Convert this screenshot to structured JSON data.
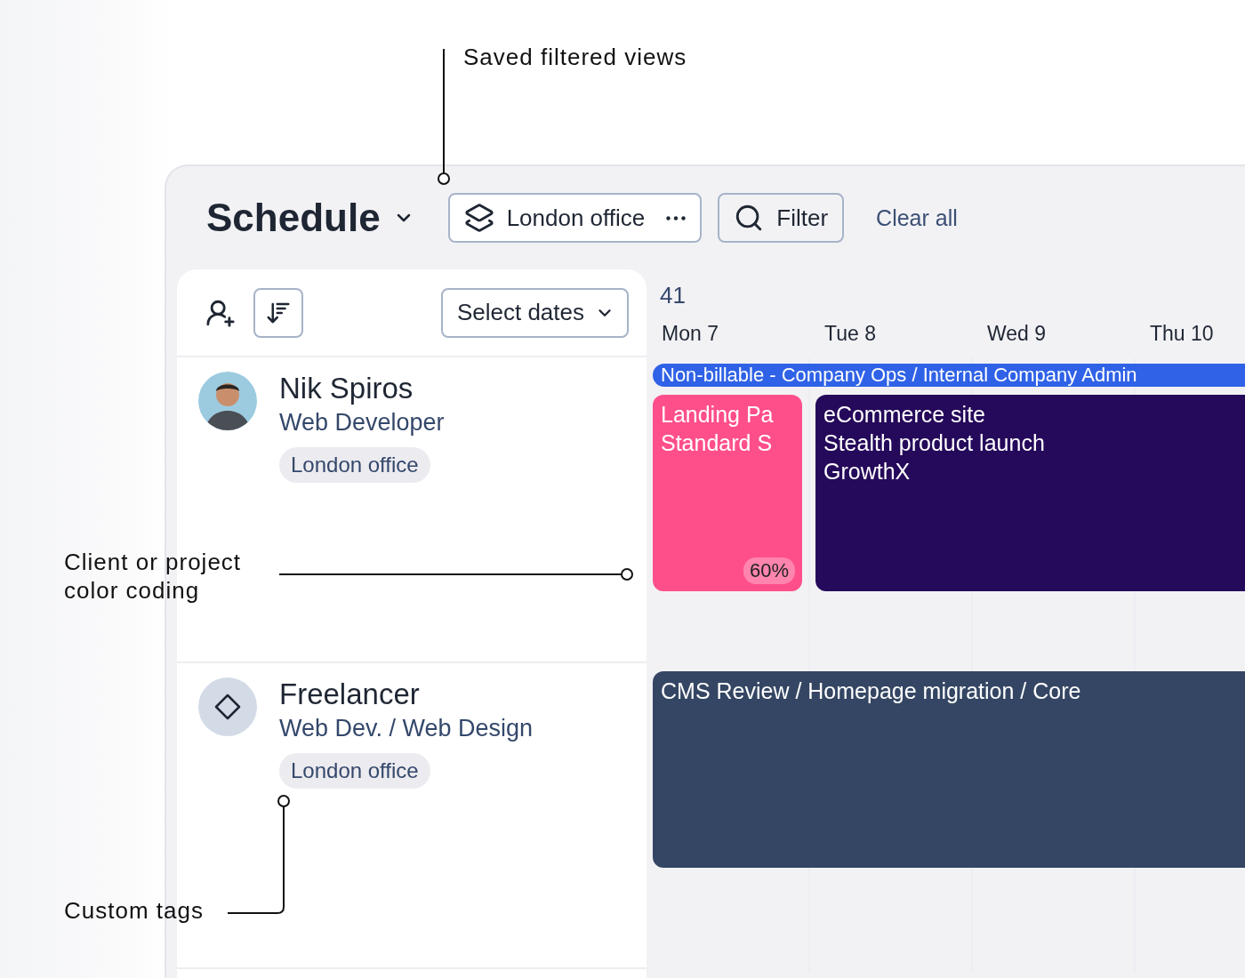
{
  "annotations": [
    {
      "kind": "top",
      "text": "Saved filtered views"
    },
    {
      "kind": "side",
      "text": "Client or project\ncolor coding"
    },
    {
      "kind": "tag",
      "text": "Custom tags"
    }
  ],
  "header": {
    "title": "Schedule",
    "saved_view": "London office",
    "filter": "Filter",
    "clear": "Clear all"
  },
  "toolbar": {
    "date_picker": "Select dates"
  },
  "calendar": {
    "week": "41",
    "days": [
      "Mon 7",
      "Tue 8",
      "Wed 9",
      "Thu 10"
    ]
  },
  "people": [
    {
      "name": "Nik Spiros",
      "role": "Web Developer",
      "tag": "London office",
      "kind": "member",
      "events": [
        {
          "kind": "bar",
          "lines": [
            "Non-billable - Company Ops / Internal Company Admin"
          ],
          "color": "#2f62e6"
        },
        {
          "kind": "block",
          "lines": [
            "Landing Pa",
            "Standard S"
          ],
          "color": "#ff4f8b",
          "badge": "60%"
        },
        {
          "kind": "block",
          "lines": [
            "eCommerce site",
            "Stealth product launch",
            "GrowthX"
          ],
          "color": "#25095a"
        }
      ]
    },
    {
      "name": "Freelancer",
      "role": "Web Dev. / Web Design",
      "tag": "London office",
      "kind": "placeholder",
      "events": [
        {
          "kind": "block",
          "lines": [
            "CMS Review / Homepage migration / Core"
          ],
          "color": "#344663"
        }
      ]
    }
  ]
}
